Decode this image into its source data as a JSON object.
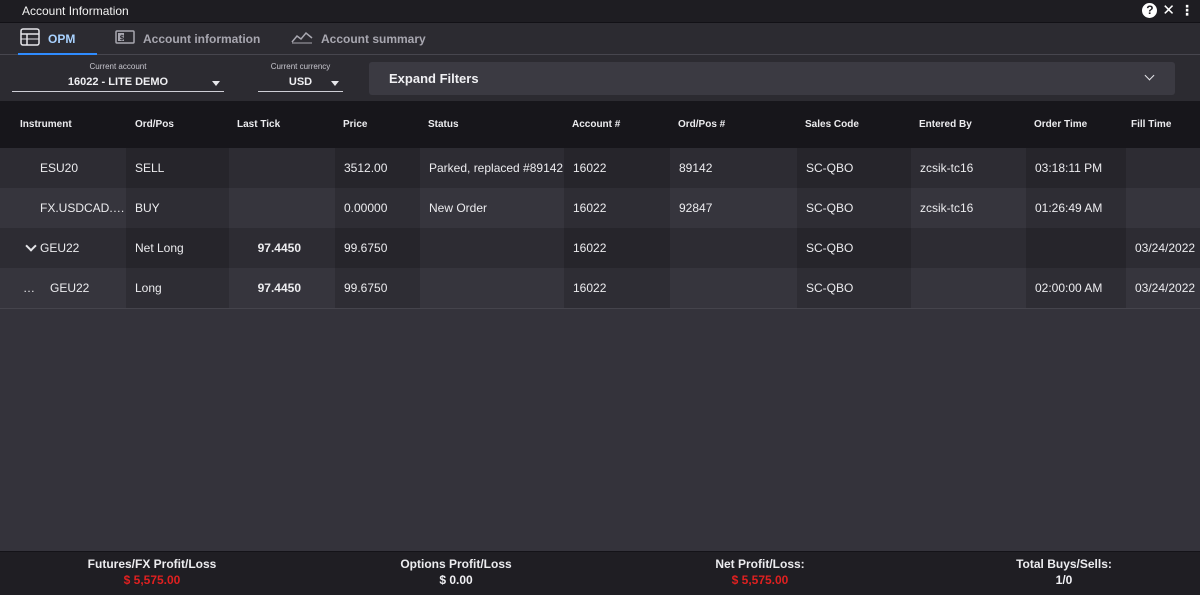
{
  "window": {
    "title": "Account Information"
  },
  "tabs": [
    {
      "label": "OPM",
      "icon": "grid-icon",
      "active": true
    },
    {
      "label": "Account information",
      "icon": "money-icon",
      "active": false
    },
    {
      "label": "Account summary",
      "icon": "line-chart-icon",
      "active": false
    }
  ],
  "filters": {
    "account_caption": "Current account",
    "account_value": "16022 - LITE DEMO",
    "currency_caption": "Current currency",
    "currency_value": "USD",
    "expand_label": "Expand Filters"
  },
  "columns": [
    "Instrument",
    "Ord/Pos",
    "Last Tick",
    "Price",
    "Status",
    "Account #",
    "Ord/Pos #",
    "Sales Code",
    "Entered By",
    "Order Time",
    "Fill Time"
  ],
  "rows": [
    {
      "expander": "",
      "instrument": "ESU20",
      "ordpos": "SELL",
      "last_tick": "",
      "price": "3512.00",
      "status": "Parked, replaced #89142",
      "account": "16022",
      "ordpos_num": "89142",
      "sales_code": "SC-QBO",
      "entered_by": "zcsik-tc16",
      "order_time": "03:18:11 PM",
      "fill_time": ""
    },
    {
      "expander": "",
      "instrument": "FX.USDCAD.US",
      "ordpos": "BUY",
      "last_tick": "",
      "price": "0.00000",
      "status": "New Order",
      "account": "16022",
      "ordpos_num": "92847",
      "sales_code": "SC-QBO",
      "entered_by": "zcsik-tc16",
      "order_time": "01:26:49 AM",
      "fill_time": ""
    },
    {
      "expander": "chevron",
      "instrument": "GEU22",
      "ordpos": "Net Long",
      "last_tick": "97.4450",
      "price": "99.6750",
      "status": "",
      "account": "16022",
      "ordpos_num": "",
      "sales_code": "SC-QBO",
      "entered_by": "",
      "order_time": "",
      "fill_time": "03/24/2022"
    },
    {
      "expander": "dots",
      "instrument": "GEU22",
      "ordpos": "Long",
      "last_tick": "97.4450",
      "price": "99.6750",
      "status": "",
      "account": "16022",
      "ordpos_num": "",
      "sales_code": "SC-QBO",
      "entered_by": "",
      "order_time": "02:00:00 AM",
      "fill_time": "03/24/2022"
    }
  ],
  "footer": {
    "futures_label": "Futures/FX Profit/Loss",
    "futures_value": "$ 5,575.00",
    "options_label": "Options Profit/Loss",
    "options_value": "$ 0.00",
    "net_label": "Net Profit/Loss:",
    "net_value": "$ 5,575.00",
    "buys_label": "Total Buys/Sells:",
    "buys_value": "1/0"
  },
  "colors": {
    "loss": "#e02020",
    "neutral": "#f0f0f3",
    "accent": "#2f8cff"
  }
}
